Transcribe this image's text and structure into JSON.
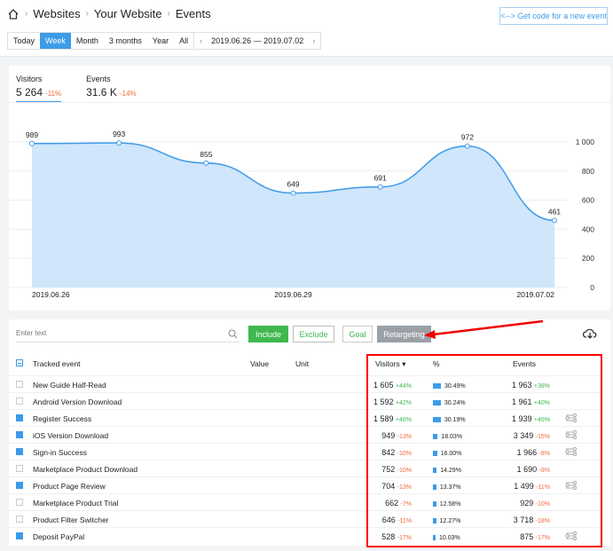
{
  "breadcrumb": [
    "Websites",
    "Your Website",
    "Events"
  ],
  "get_code": "<--> Get code for a new event",
  "periods": [
    "Today",
    "Week",
    "Month",
    "3 months",
    "Year",
    "All"
  ],
  "active_period": "Week",
  "date_range": "2019.06.26 — 2019.07.02",
  "summary": {
    "visitors_label": "Visitors",
    "visitors": "5 264",
    "visitors_delta": "-11%",
    "events_label": "Events",
    "events": "31.6 K",
    "events_delta": "-14%"
  },
  "chart_data": {
    "type": "area",
    "x": [
      "2019.06.26",
      "2019.06.27",
      "2019.06.28",
      "2019.06.29",
      "2019.06.30",
      "2019.07.01",
      "2019.07.02"
    ],
    "values": [
      989,
      993,
      855,
      649,
      691,
      972,
      461
    ],
    "x_tick_labels": [
      "2019.06.26",
      "2019.06.29",
      "2019.07.02"
    ],
    "y_ticks": [
      "0",
      "200",
      "400",
      "600",
      "800",
      "1 000"
    ],
    "ylim": [
      0,
      1000
    ],
    "color": "#3d9be9"
  },
  "filter": {
    "placeholder": "Enter text",
    "include": "Include",
    "exclude": "Exclude",
    "goal": "Goal",
    "retargeting": "Retargeting"
  },
  "columns": {
    "event": "Tracked event",
    "value": "Value",
    "unit": "Unit",
    "visitors": "Visitors ▾",
    "pct": "%",
    "events": "Events"
  },
  "rows": [
    {
      "name": "New Guide Half-Read",
      "checked": false,
      "visitors": "1 605",
      "vd": "+44%",
      "pct": "30.49%",
      "p": 30.49,
      "events": "1 963",
      "ed": "+38%",
      "retarget": false
    },
    {
      "name": "Android Version Download",
      "checked": false,
      "visitors": "1 592",
      "vd": "+42%",
      "pct": "30.24%",
      "p": 30.24,
      "events": "1 961",
      "ed": "+40%",
      "retarget": false
    },
    {
      "name": "Register Success",
      "checked": true,
      "visitors": "1 589",
      "vd": "+46%",
      "pct": "30.19%",
      "p": 30.19,
      "events": "1 939",
      "ed": "+46%",
      "retarget": true
    },
    {
      "name": "iOS Version Download",
      "checked": true,
      "visitors": "949",
      "vd": "-13%",
      "pct": "18.03%",
      "p": 18.03,
      "events": "3 349",
      "ed": "-15%",
      "retarget": true
    },
    {
      "name": "Sign-in Success",
      "checked": true,
      "visitors": "842",
      "vd": "-10%",
      "pct": "16.00%",
      "p": 16.0,
      "events": "1 966",
      "ed": "-8%",
      "retarget": true
    },
    {
      "name": "Marketplace Product Download",
      "checked": false,
      "visitors": "752",
      "vd": "-10%",
      "pct": "14.29%",
      "p": 14.29,
      "events": "1 690",
      "ed": "-8%",
      "retarget": false
    },
    {
      "name": "Product Page Review",
      "checked": true,
      "visitors": "704",
      "vd": "-13%",
      "pct": "13.37%",
      "p": 13.37,
      "events": "1 499",
      "ed": "-11%",
      "retarget": true
    },
    {
      "name": "Marketplace Product Trial",
      "checked": false,
      "visitors": "662",
      "vd": "-7%",
      "pct": "12.58%",
      "p": 12.58,
      "events": "929",
      "ed": "-10%",
      "retarget": false
    },
    {
      "name": "Product Filter Switcher",
      "checked": false,
      "visitors": "646",
      "vd": "-11%",
      "pct": "12.27%",
      "p": 12.27,
      "events": "3 718",
      "ed": "-18%",
      "retarget": false
    },
    {
      "name": "Deposit PayPal",
      "checked": true,
      "visitors": "528",
      "vd": "-17%",
      "pct": "10.03%",
      "p": 10.03,
      "events": "875",
      "ed": "-17%",
      "retarget": true
    }
  ]
}
